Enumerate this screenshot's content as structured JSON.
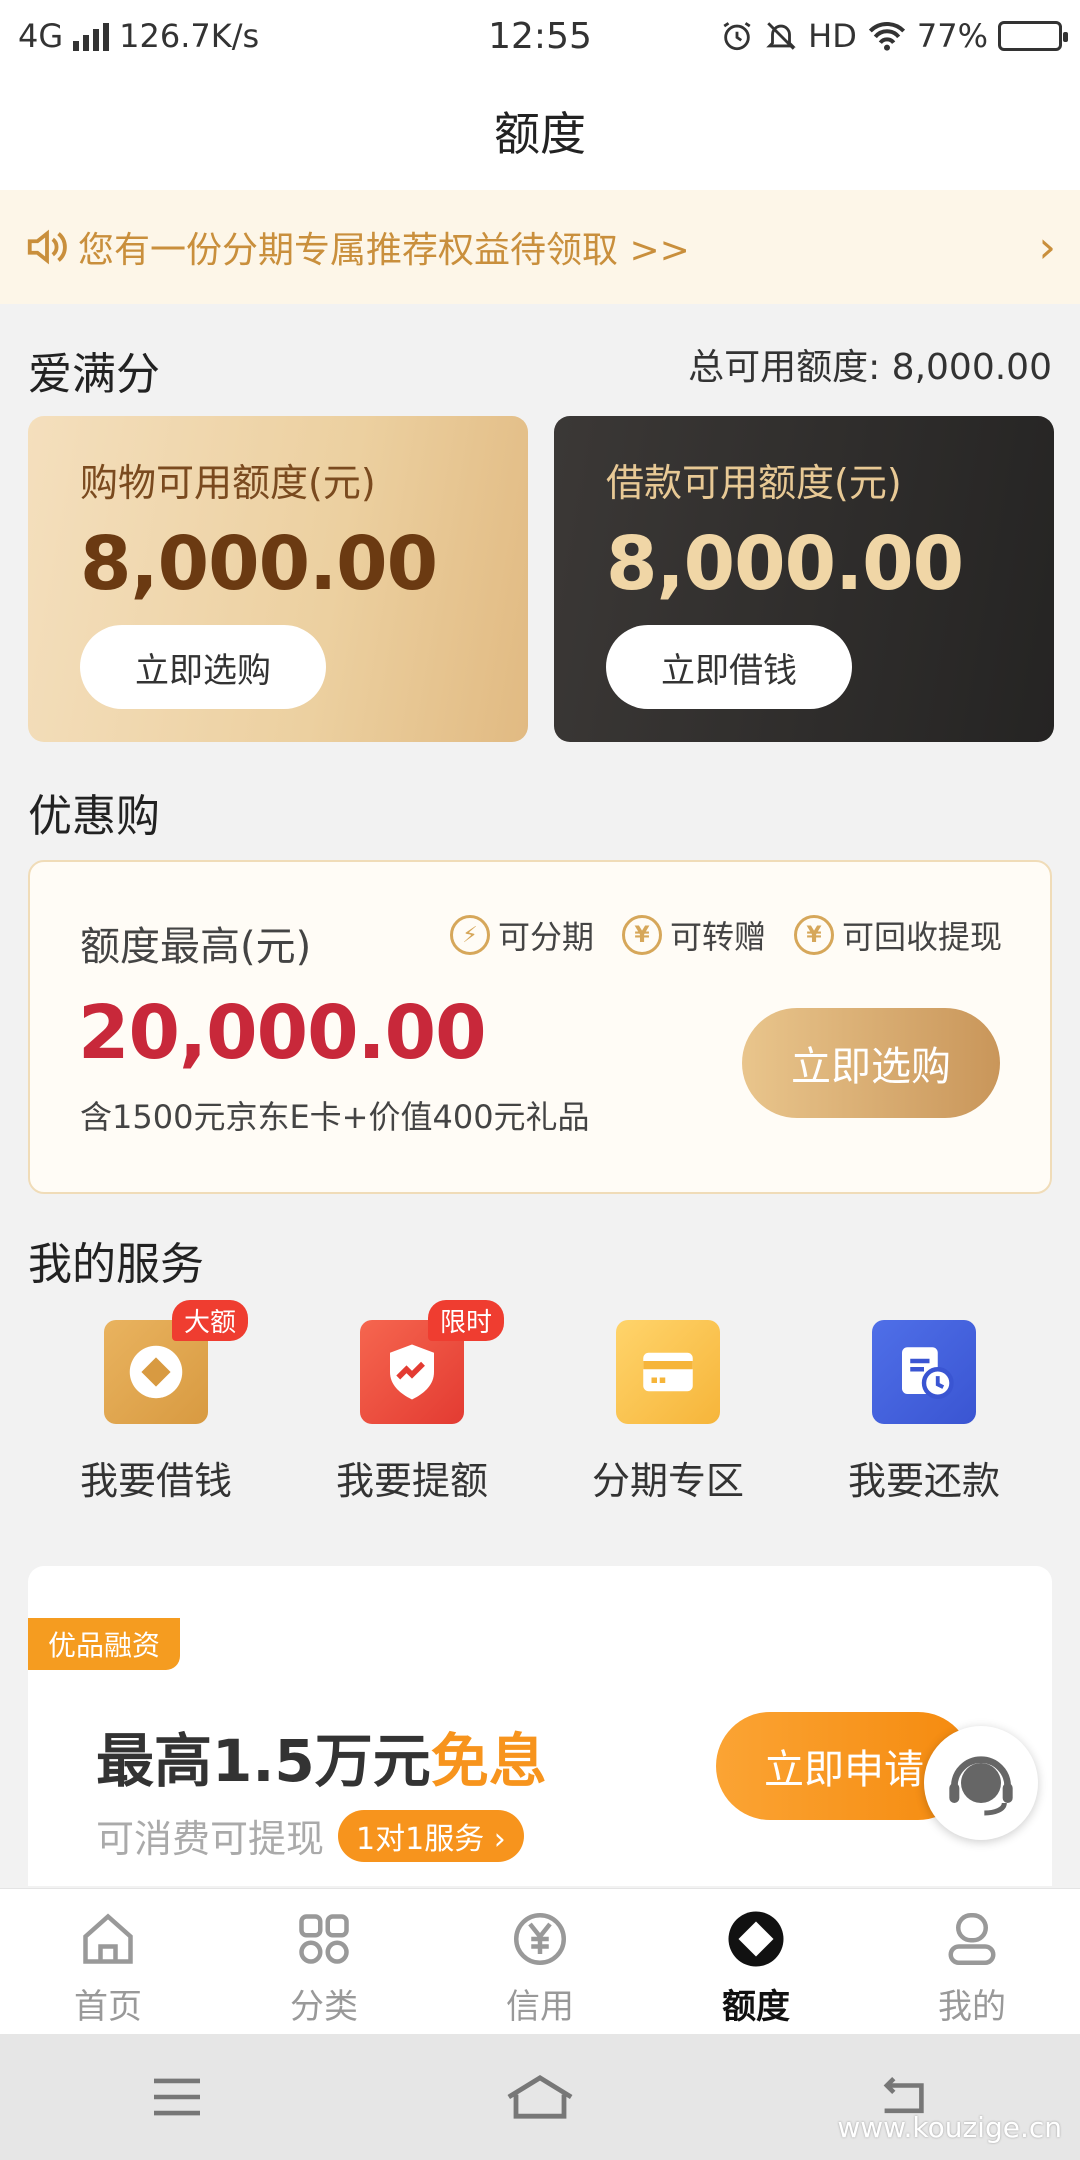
{
  "status_bar": {
    "network": "4G",
    "speed": "126.7K/s",
    "time": "12:55",
    "hd": "HD",
    "battery": "77%",
    "battery_level": 0.77
  },
  "header": {
    "title": "额度"
  },
  "notice": {
    "text": "您有一份分期专属推荐权益待领取 >>"
  },
  "credit": {
    "section_title": "爱满分",
    "total": "总可用额度: 8,000.00",
    "shopping": {
      "label": "购物可用额度(元)",
      "amount": "8,000.00",
      "button": "立即选购"
    },
    "loan": {
      "label": "借款可用额度(元)",
      "amount": "8,000.00",
      "button": "立即借钱"
    }
  },
  "promo": {
    "section_title": "优惠购",
    "label": "额度最高(元)",
    "tags": [
      "可分期",
      "可转赠",
      "可回收提现"
    ],
    "amount": "20,000.00",
    "sub": "含1500元京东E卡+价值400元礼品",
    "button": "立即选购"
  },
  "services": {
    "section_title": "我的服务",
    "items": [
      {
        "label": "我要借钱",
        "badge": "大额"
      },
      {
        "label": "我要提额",
        "badge": "限时"
      },
      {
        "label": "分期专区",
        "badge": ""
      },
      {
        "label": "我要还款",
        "badge": ""
      }
    ]
  },
  "ad": {
    "tag": "优品融资",
    "title_main": "最高1.5万元",
    "title_highlight": "免息",
    "sub": "可消费可提现",
    "pill": "1对1服务 ›",
    "button": "立即申请"
  },
  "tabs": [
    {
      "label": "首页",
      "icon": "home-icon"
    },
    {
      "label": "分类",
      "icon": "grid-icon"
    },
    {
      "label": "信用",
      "icon": "yuan-icon"
    },
    {
      "label": "额度",
      "icon": "diamond-icon",
      "active": true
    },
    {
      "label": "我的",
      "icon": "person-icon"
    }
  ],
  "watermark": "www.kouzige.cn"
}
